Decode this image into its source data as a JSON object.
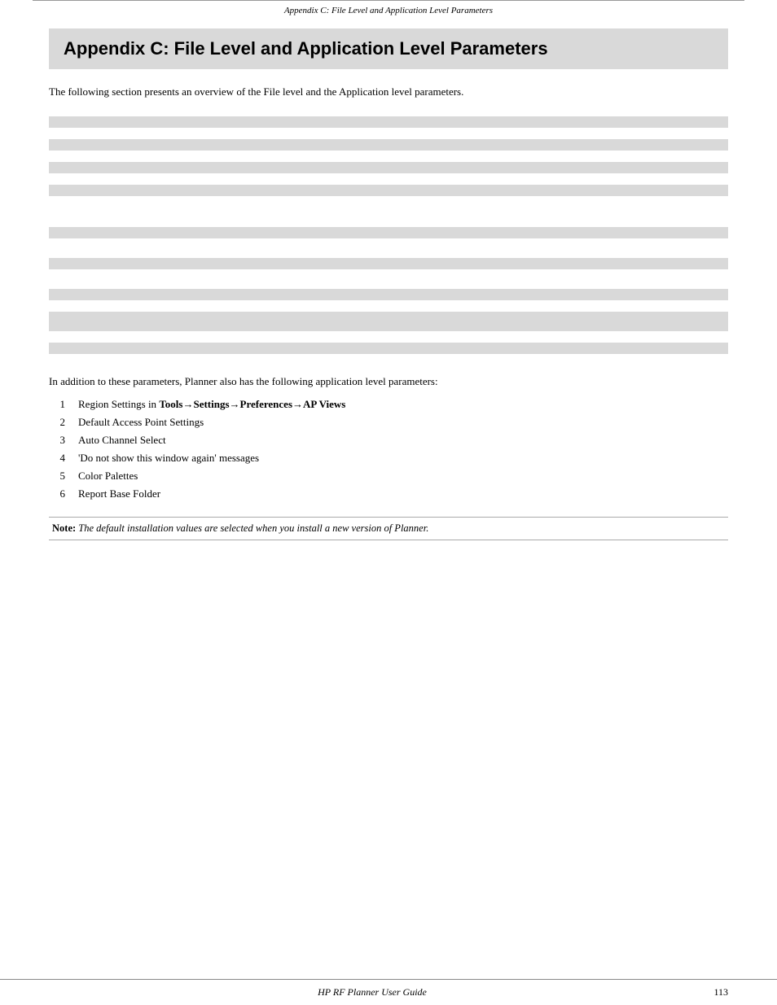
{
  "header": {
    "text": "Appendix C: File Level and Application Level Parameters"
  },
  "chapter": {
    "title": "Appendix C: File Level and Application Level Parameters"
  },
  "intro": {
    "text": "The following section presents an overview of the File level and the Application level parameters."
  },
  "table1": {
    "rows": 8,
    "cols": 5
  },
  "table2": {
    "rows": 9,
    "cols": 5
  },
  "additional_text": "In addition to these parameters, Planner also has the following application level parameters:",
  "list": {
    "items": [
      {
        "num": "1",
        "text_plain": "Region Settings in ",
        "text_bold": "Tools→Settings→Preferences→AP Views",
        "text_after": ""
      },
      {
        "num": "2",
        "text_plain": "Default Access Point Settings",
        "text_bold": "",
        "text_after": ""
      },
      {
        "num": "3",
        "text_plain": "Auto Channel Select",
        "text_bold": "",
        "text_after": ""
      },
      {
        "num": "4",
        "text_plain": "‘Do not show this window again’ messages",
        "text_bold": "",
        "text_after": ""
      },
      {
        "num": "5",
        "text_plain": "Color Palettes",
        "text_bold": "",
        "text_after": ""
      },
      {
        "num": "6",
        "text_plain": "Report Base Folder",
        "text_bold": "",
        "text_after": ""
      }
    ]
  },
  "note": {
    "label": "Note:",
    "text": " The default installation values are selected when you install a new version of Planner."
  },
  "footer": {
    "center": "HP RF Planner User Guide",
    "page": "113"
  }
}
